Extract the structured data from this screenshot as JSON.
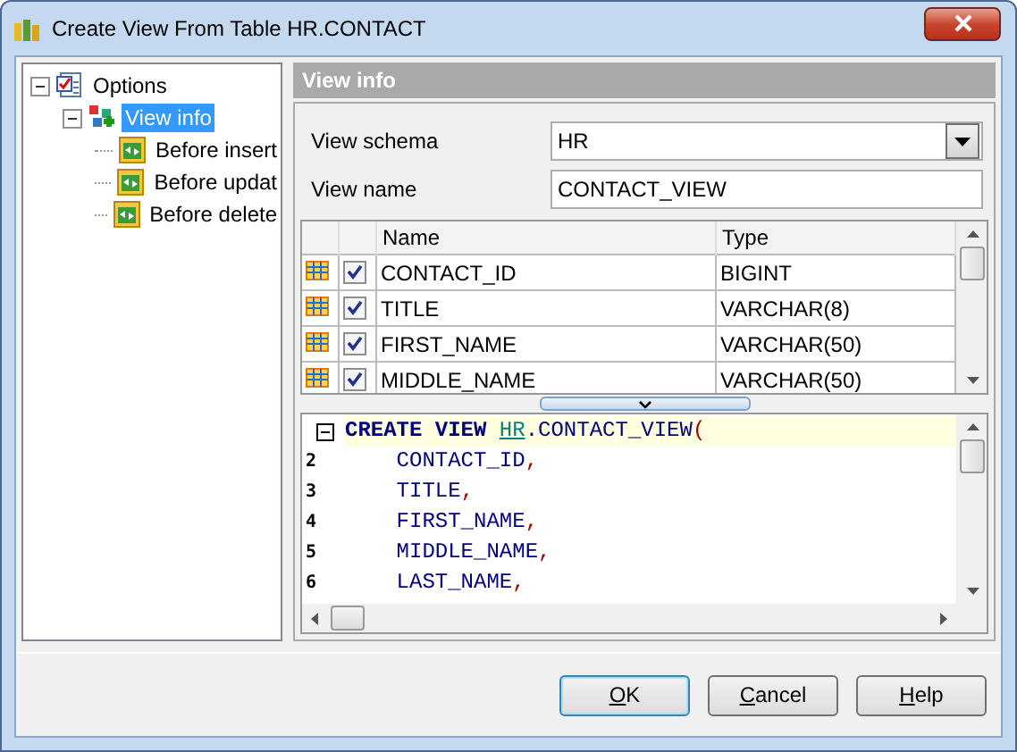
{
  "window": {
    "title": "Create View From Table HR.CONTACT"
  },
  "tree": [
    {
      "label": "Options",
      "expanded": true,
      "selected": false,
      "kind": "options",
      "children": [
        {
          "label": "View info",
          "expanded": true,
          "selected": true,
          "kind": "view",
          "children": [
            {
              "label": "Before insert",
              "selected": false,
              "kind": "trigger"
            },
            {
              "label": "Before updat",
              "selected": false,
              "kind": "trigger"
            },
            {
              "label": "Before delete",
              "selected": false,
              "kind": "trigger"
            }
          ]
        }
      ]
    }
  ],
  "section_title": "View info",
  "form": [
    {
      "label": "View schema",
      "kind": "dropdown",
      "value": "HR"
    },
    {
      "label": "View name",
      "kind": "text",
      "value": "CONTACT_VIEW"
    }
  ],
  "table": {
    "columns": [
      "Name",
      "Type"
    ],
    "rows": [
      {
        "checked": true,
        "name": "CONTACT_ID",
        "type": "BIGINT"
      },
      {
        "checked": true,
        "name": "TITLE",
        "type": "VARCHAR(8)"
      },
      {
        "checked": true,
        "name": "FIRST_NAME",
        "type": "VARCHAR(50)"
      },
      {
        "checked": true,
        "name": "MIDDLE_NAME",
        "type": "VARCHAR(50)"
      }
    ]
  },
  "editor": {
    "lines": [
      {
        "current": true,
        "tokens": [
          {
            "text": "CREATE VIEW ",
            "kind": "keyword"
          },
          {
            "text": "HR",
            "kind": "schema"
          },
          {
            "text": ".CONTACT_VIEW",
            "kind": "ident"
          },
          {
            "text": "(",
            "kind": "punct"
          }
        ]
      },
      {
        "number": "2",
        "current": false,
        "tokens": [
          {
            "text": "    CONTACT_ID",
            "kind": "ident"
          },
          {
            "text": ",",
            "kind": "punct"
          }
        ]
      },
      {
        "number": "3",
        "current": false,
        "tokens": [
          {
            "text": "    TITLE",
            "kind": "ident"
          },
          {
            "text": ",",
            "kind": "punct"
          }
        ]
      },
      {
        "number": "4",
        "current": false,
        "tokens": [
          {
            "text": "    FIRST_NAME",
            "kind": "ident"
          },
          {
            "text": ",",
            "kind": "punct"
          }
        ]
      },
      {
        "number": "5",
        "current": false,
        "tokens": [
          {
            "text": "    MIDDLE_NAME",
            "kind": "ident"
          },
          {
            "text": ",",
            "kind": "punct"
          }
        ]
      },
      {
        "number": "6",
        "current": false,
        "tokens": [
          {
            "text": "    LAST_NAME",
            "kind": "ident"
          },
          {
            "text": ",",
            "kind": "punct"
          }
        ]
      }
    ]
  },
  "buttons": [
    {
      "label": "OK",
      "default": true
    },
    {
      "label": "Cancel",
      "default": false
    },
    {
      "label": "Help",
      "default": false
    }
  ]
}
